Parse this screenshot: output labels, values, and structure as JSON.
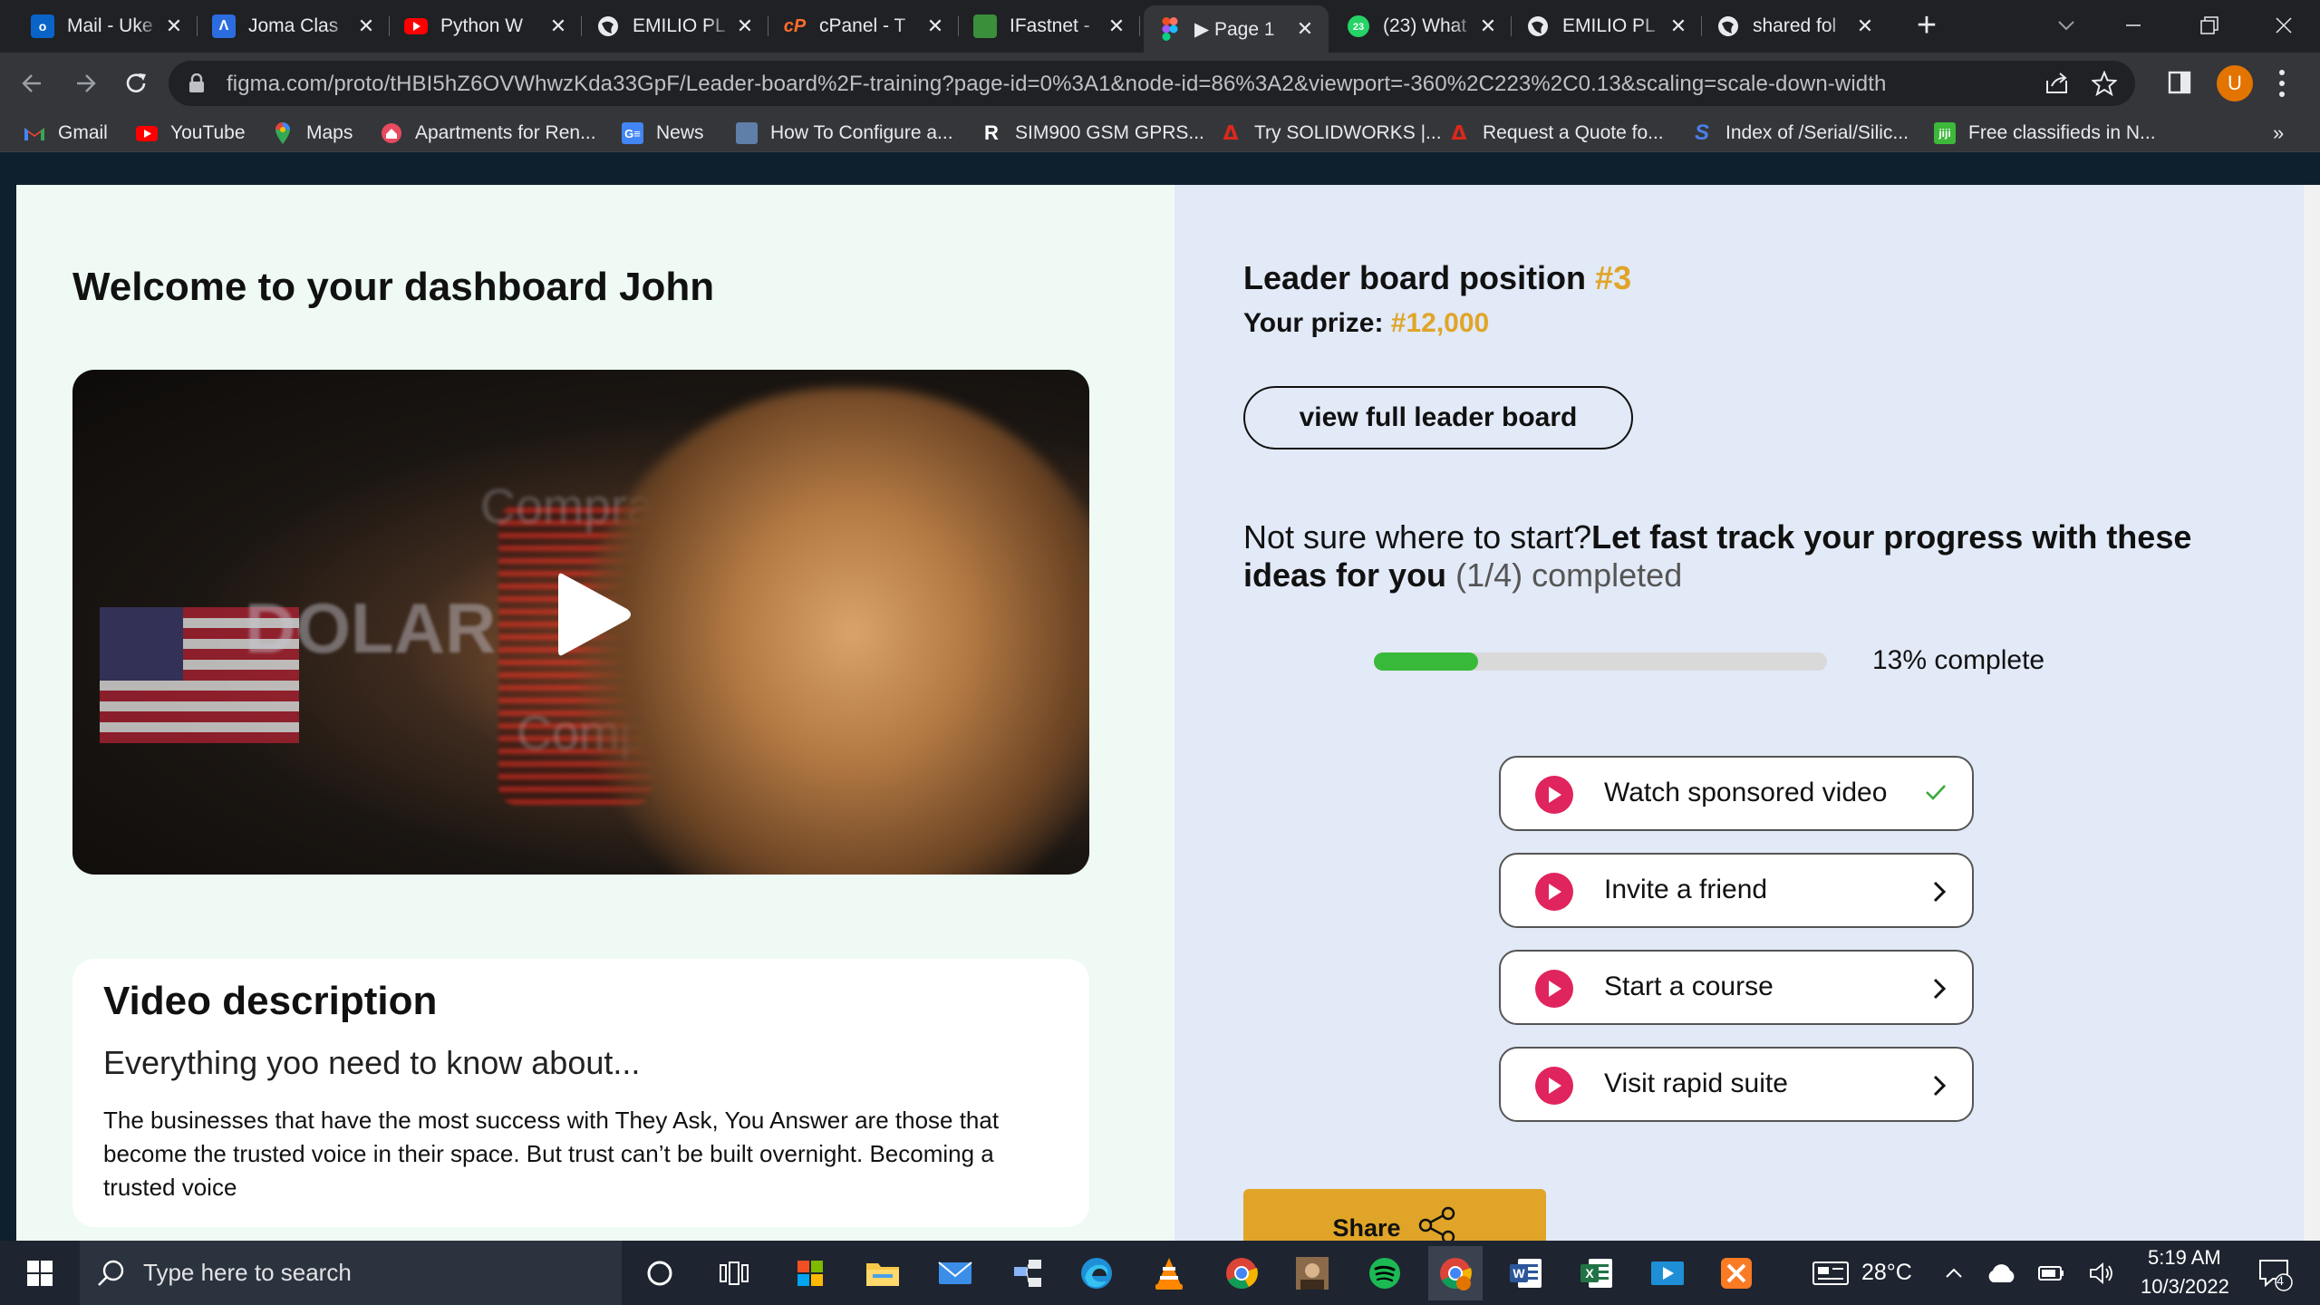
{
  "browser": {
    "tabs": [
      {
        "title": "Mail - Uke",
        "icon": "outlook-icon"
      },
      {
        "title": "Joma Clas",
        "icon": "joma-icon"
      },
      {
        "title": "Python W",
        "icon": "youtube-icon"
      },
      {
        "title": "EMILIO PL",
        "icon": "globe-icon"
      },
      {
        "title": "cPanel - T",
        "icon": "cpanel-icon"
      },
      {
        "title": "IFastnet -",
        "icon": "ifastnet-icon"
      },
      {
        "title": "▶ Page 1",
        "icon": "figma-icon"
      },
      {
        "title": "(23) What",
        "icon": "whatsapp-icon"
      },
      {
        "title": "EMILIO PL",
        "icon": "globe-icon"
      },
      {
        "title": "shared fol",
        "icon": "globe-icon"
      }
    ],
    "url": "figma.com/proto/tHBI5hZ6OVWhwzKda33GpF/Leader-board%2F-training?page-id=0%3A1&node-id=86%3A2&viewport=-360%2C223%2C0.13&scaling=scale-down-width",
    "profile_initial": "U",
    "bookmarks": [
      {
        "label": "Gmail",
        "icon": "gmail-icon"
      },
      {
        "label": "YouTube",
        "icon": "youtube-icon"
      },
      {
        "label": "Maps",
        "icon": "maps-icon"
      },
      {
        "label": "Apartments for Ren...",
        "icon": "apartments-icon"
      },
      {
        "label": "News",
        "icon": "news-icon"
      },
      {
        "label": "How To Configure a...",
        "icon": "bookmark-icon"
      },
      {
        "label": "SIM900 GSM GPRS...",
        "icon": "r-icon"
      },
      {
        "label": "Try SOLIDWORKS |...",
        "icon": "solidworks-icon"
      },
      {
        "label": "Request a Quote fo...",
        "icon": "quote-icon"
      },
      {
        "label": "Index of /Serial/Silic...",
        "icon": "s-icon"
      },
      {
        "label": "Free classifieds in N...",
        "icon": "jiji-icon"
      }
    ],
    "bookmarks_more": "»"
  },
  "dashboard": {
    "welcome": "Welcome to your dashboard John",
    "video_description": {
      "title": "Video description",
      "subtitle": "Everything yoo need to know about...",
      "body": "The businesses that have the most success with They Ask, You Answer are those that become the trusted voice in their space. But trust can’t be built overnight. Becoming a trusted voice"
    },
    "video_overlay_text": {
      "word1": "DOLAR",
      "word2": "Compra",
      "word3": "Comp"
    },
    "leaderboard": {
      "position_label": "Leader board position",
      "position_value": "#3",
      "prize_label": "Your prize:",
      "prize_value": "#12,000",
      "view_button": "view full leader board"
    },
    "ideas": {
      "lead": "Not sure where to start?",
      "bold": "Let fast track your progress with these ideas for you",
      "count": "(1/4)",
      "suffix": "completed"
    },
    "progress": {
      "percent": 13,
      "label": "13% complete"
    },
    "tasks": [
      {
        "label": "Watch sponsored video",
        "state": "done",
        "trailing_icon": "checkmark-icon"
      },
      {
        "label": "Invite a friend",
        "state": "todo",
        "trailing_icon": "chevron-right-icon"
      },
      {
        "label": "Start a course",
        "state": "todo",
        "trailing_icon": "chevron-right-icon"
      },
      {
        "label": "Visit rapid suite",
        "state": "todo",
        "trailing_icon": "chevron-right-icon"
      }
    ],
    "share_button": "Share"
  },
  "taskbar": {
    "search_placeholder": "Type here to search",
    "weather": "28°C",
    "time": "5:19 AM",
    "date": "10/3/2022",
    "notification_count": "4"
  },
  "colors": {
    "accent_gold": "#e0a528",
    "progress_green": "#39b93a",
    "task_play_pink": "#e0245e",
    "left_panel_bg": "#eefaf3",
    "right_panel_bg": "#e2e9f7"
  }
}
